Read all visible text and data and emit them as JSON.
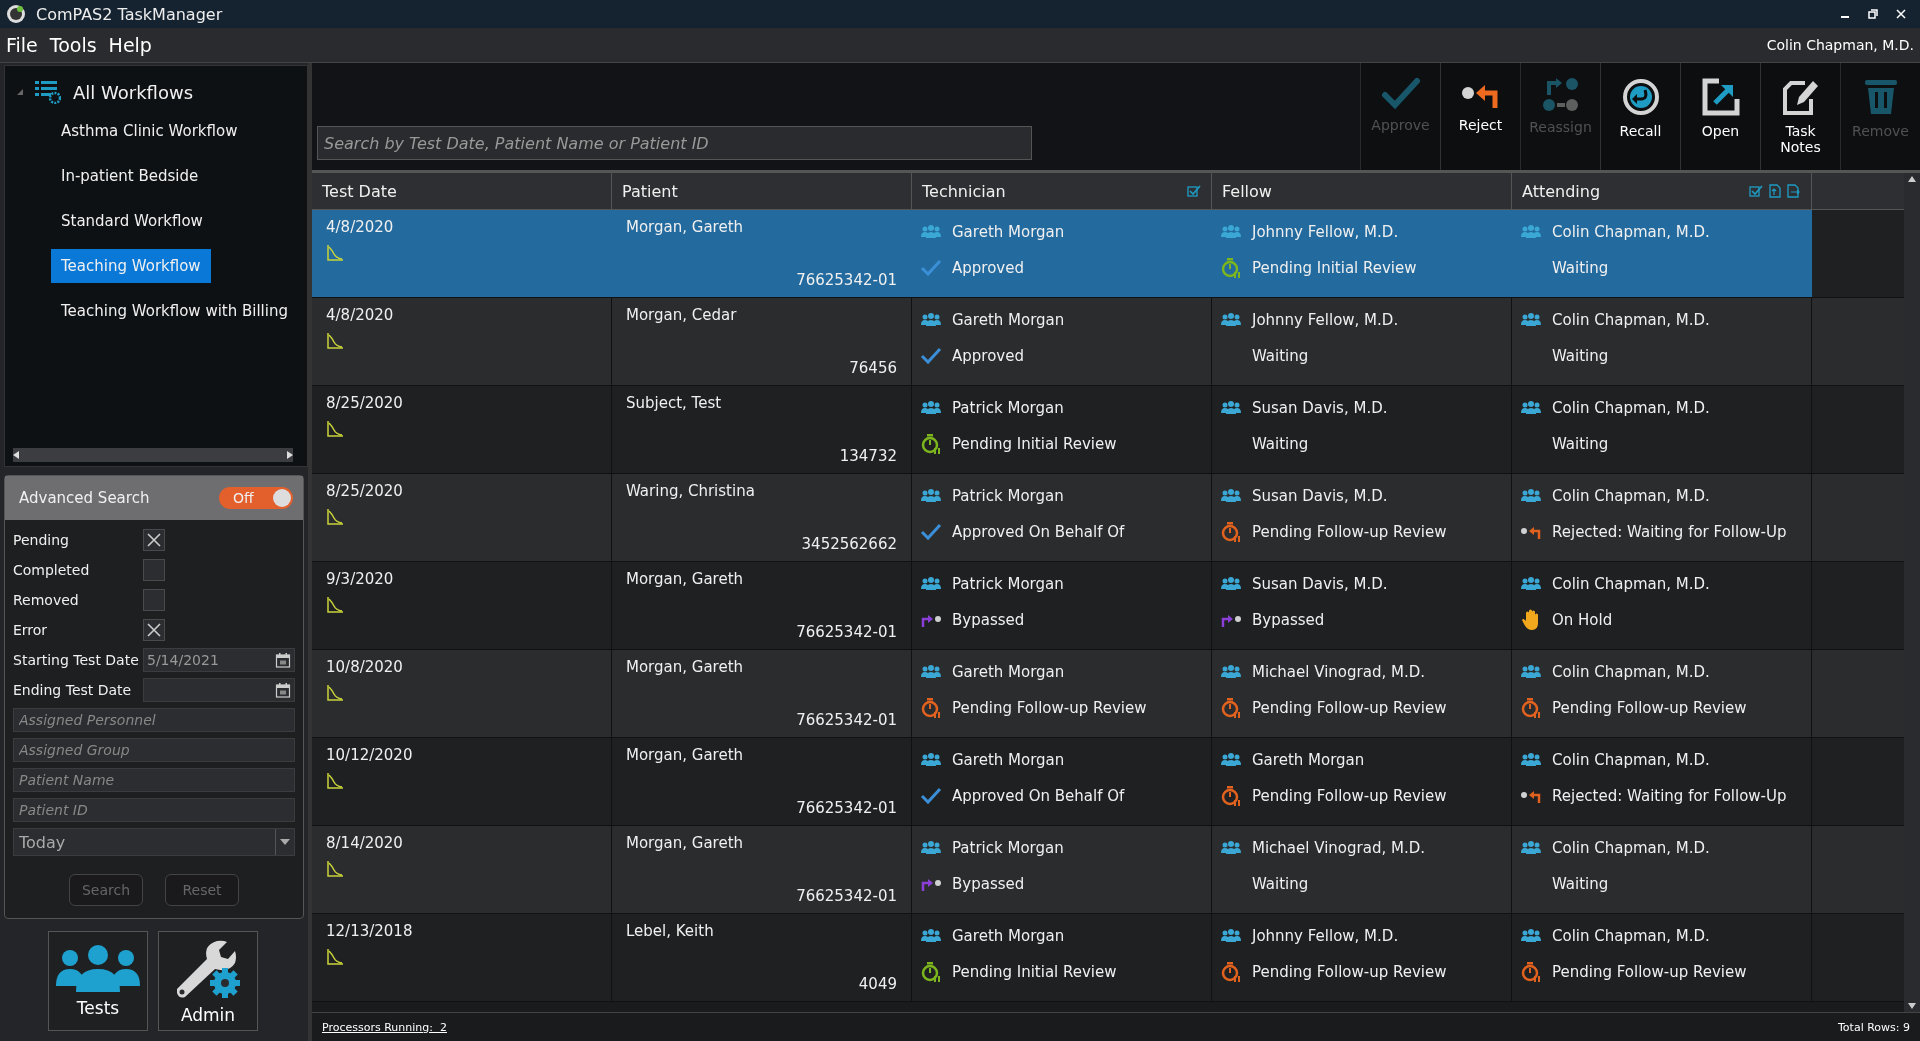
{
  "window": {
    "title": "ComPAS2 TaskManager"
  },
  "menu": [
    "File",
    "Tools",
    "Help"
  ],
  "user": "Colin Chapman, M.D.",
  "tree": {
    "label": "All Workflows",
    "expanded": true,
    "children": [
      {
        "label": "Asthma Clinic Workflow",
        "selected": false
      },
      {
        "label": "In-patient Bedside",
        "selected": false
      },
      {
        "label": "Standard Workflow",
        "selected": false
      },
      {
        "label": "Teaching Workflow",
        "selected": true
      },
      {
        "label": "Teaching Workflow with Billing",
        "selected": false
      }
    ]
  },
  "advanced_search": {
    "title": "Advanced Search",
    "toggle": {
      "label": "Off",
      "on": false
    },
    "filters": [
      {
        "label": "Pending",
        "checked": true
      },
      {
        "label": "Completed",
        "checked": false
      },
      {
        "label": "Removed",
        "checked": false
      },
      {
        "label": "Error",
        "checked": true
      }
    ],
    "date_fields": [
      {
        "label": "Starting Test Date",
        "value": "5/14/2021"
      },
      {
        "label": "Ending Test Date"
      }
    ],
    "text_fields": [
      {
        "placeholder": "Assigned Personnel"
      },
      {
        "placeholder": "Assigned Group"
      },
      {
        "placeholder": "Patient Name"
      },
      {
        "placeholder": "Patient ID"
      }
    ],
    "dropdown": {
      "value": "Today"
    },
    "buttons": [
      {
        "label": "Search",
        "disabled": true
      },
      {
        "label": "Reset",
        "disabled": true
      }
    ]
  },
  "nav_tiles": [
    {
      "label": "Tests",
      "kind": "tests"
    },
    {
      "label": "Admin",
      "kind": "admin"
    }
  ],
  "search": {
    "placeholder": "Search by Test Date, Patient Name or Patient ID"
  },
  "toolbar": [
    {
      "label": "Approve",
      "kind": "approve",
      "disabled": true
    },
    {
      "label": "Reject",
      "kind": "reject",
      "disabled": false
    },
    {
      "label": "Reassign",
      "kind": "reassign",
      "disabled": true
    },
    {
      "label": "Recall",
      "kind": "recall",
      "disabled": false
    },
    {
      "label": "Open",
      "kind": "open",
      "disabled": false
    },
    {
      "label": "Task Notes",
      "kind": "notes",
      "disabled": false
    },
    {
      "label": "Remove",
      "kind": "remove",
      "disabled": true
    }
  ],
  "table": {
    "columns": [
      "Test Date",
      "Patient",
      "Technician",
      "Fellow",
      "Attending"
    ],
    "rows": [
      {
        "selected": true,
        "test_date": "4/8/2020",
        "patient": "Morgan, Gareth",
        "patient_id": "76625342-01",
        "technician": {
          "name": "Gareth Morgan",
          "status": "Approved",
          "kind": "approved"
        },
        "fellow": {
          "name": "Johnny Fellow, M.D.",
          "status": "Pending Initial Review",
          "kind": "pending_initial"
        },
        "attending": {
          "name": "Colin Chapman, M.D.",
          "status": "Waiting",
          "kind": "waiting"
        }
      },
      {
        "selected": false,
        "test_date": "4/8/2020",
        "patient": "Morgan, Cedar",
        "patient_id": "76456",
        "technician": {
          "name": "Gareth Morgan",
          "status": "Approved",
          "kind": "approved"
        },
        "fellow": {
          "name": "Johnny Fellow, M.D.",
          "status": "Waiting",
          "kind": "waiting"
        },
        "attending": {
          "name": "Colin Chapman, M.D.",
          "status": "Waiting",
          "kind": "waiting"
        }
      },
      {
        "selected": false,
        "test_date": "8/25/2020",
        "patient": "Subject, Test",
        "patient_id": "134732",
        "technician": {
          "name": "Patrick Morgan",
          "status": "Pending Initial Review",
          "kind": "pending_initial"
        },
        "fellow": {
          "name": "Susan Davis, M.D.",
          "status": "Waiting",
          "kind": "waiting"
        },
        "attending": {
          "name": "Colin Chapman, M.D.",
          "status": "Waiting",
          "kind": "waiting"
        }
      },
      {
        "selected": false,
        "test_date": "8/25/2020",
        "patient": "Waring, Christina",
        "patient_id": "3452562662",
        "technician": {
          "name": "Patrick Morgan",
          "status": "Approved On Behalf Of",
          "kind": "approved"
        },
        "fellow": {
          "name": "Susan Davis, M.D.",
          "status": "Pending Follow-up Review",
          "kind": "pending_followup"
        },
        "attending": {
          "name": "Colin Chapman, M.D.",
          "status": "Rejected: Waiting for Follow-Up",
          "kind": "rejected"
        }
      },
      {
        "selected": false,
        "test_date": "9/3/2020",
        "patient": "Morgan, Gareth",
        "patient_id": "76625342-01",
        "technician": {
          "name": "Patrick Morgan",
          "status": "Bypassed",
          "kind": "bypassed"
        },
        "fellow": {
          "name": "Susan Davis, M.D.",
          "status": "Bypassed",
          "kind": "bypassed"
        },
        "attending": {
          "name": "Colin Chapman, M.D.",
          "status": "On Hold",
          "kind": "on_hold"
        }
      },
      {
        "selected": false,
        "test_date": "10/8/2020",
        "patient": "Morgan, Gareth",
        "patient_id": "76625342-01",
        "technician": {
          "name": "Gareth Morgan",
          "status": "Pending Follow-up Review",
          "kind": "pending_followup"
        },
        "fellow": {
          "name": "Michael Vinograd, M.D.",
          "status": "Pending Follow-up Review",
          "kind": "pending_followup"
        },
        "attending": {
          "name": "Colin Chapman, M.D.",
          "status": "Pending Follow-up Review",
          "kind": "pending_followup"
        }
      },
      {
        "selected": false,
        "test_date": "10/12/2020",
        "patient": "Morgan, Gareth",
        "patient_id": "76625342-01",
        "technician": {
          "name": "Gareth Morgan",
          "status": "Approved On Behalf Of",
          "kind": "approved"
        },
        "fellow": {
          "name": "Gareth Morgan",
          "status": "Pending Follow-up Review",
          "kind": "pending_followup"
        },
        "attending": {
          "name": "Colin Chapman, M.D.",
          "status": "Rejected: Waiting for Follow-Up",
          "kind": "rejected"
        }
      },
      {
        "selected": false,
        "test_date": "8/14/2020",
        "patient": "Morgan, Gareth",
        "patient_id": "76625342-01",
        "technician": {
          "name": "Patrick Morgan",
          "status": "Bypassed",
          "kind": "bypassed"
        },
        "fellow": {
          "name": "Michael Vinograd, M.D.",
          "status": "Waiting",
          "kind": "waiting"
        },
        "attending": {
          "name": "Colin Chapman, M.D.",
          "status": "Waiting",
          "kind": "waiting"
        }
      },
      {
        "selected": false,
        "test_date": "12/13/2018",
        "patient": "Lebel, Keith",
        "patient_id": "4049",
        "technician": {
          "name": "Gareth Morgan",
          "status": "Pending Initial Review",
          "kind": "pending_initial"
        },
        "fellow": {
          "name": "Johnny Fellow, M.D.",
          "status": "Pending Follow-up Review",
          "kind": "pending_followup"
        },
        "attending": {
          "name": "Colin Chapman, M.D.",
          "status": "Pending Follow-up Review",
          "kind": "pending_followup"
        }
      }
    ]
  },
  "status_bar": {
    "processors_label": "Processors Running:",
    "processors_count": "2",
    "total_rows": "Total Rows:",
    "total_count": "9"
  }
}
